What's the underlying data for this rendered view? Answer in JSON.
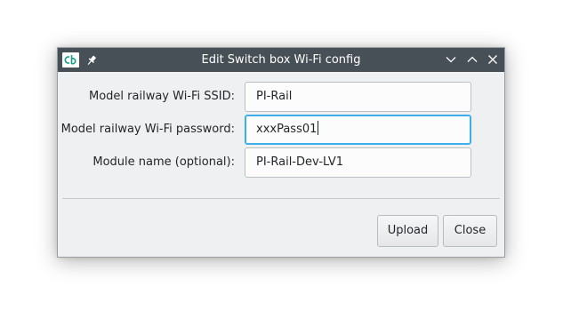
{
  "window": {
    "title": "Edit Switch box Wi-Fi config",
    "app_icon": "cb-logo-icon",
    "titlebar_buttons": [
      "pin-icon",
      "minimize-icon",
      "maximize-icon",
      "close-icon"
    ]
  },
  "form": {
    "ssid": {
      "label": "Model railway Wi-Fi SSID:",
      "value": "PI-Rail"
    },
    "password": {
      "label": "Model railway Wi-Fi password:",
      "value": "xxxPass01"
    },
    "module_name": {
      "label": "Module name (optional):",
      "value": "PI-Rail-Dev-LV1"
    }
  },
  "buttons": {
    "upload": "Upload",
    "close": "Close"
  },
  "colors": {
    "titlebar": "#475057",
    "window_bg": "#eff0f1",
    "focus_accent": "#3daee9",
    "logo_accent": "#1a9e8a"
  }
}
